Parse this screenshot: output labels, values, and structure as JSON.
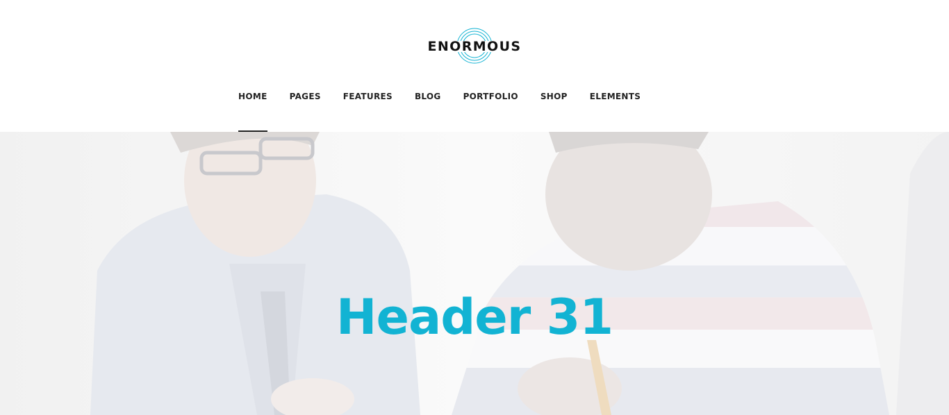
{
  "brand": {
    "name": "ENORMOUS",
    "accent_color": "#12b3d3"
  },
  "nav": {
    "items": [
      {
        "label": "HOME",
        "active": true
      },
      {
        "label": "PAGES"
      },
      {
        "label": "FEATURES"
      },
      {
        "label": "BLOG"
      },
      {
        "label": "PORTFOLIO"
      },
      {
        "label": "SHOP"
      },
      {
        "label": "ELEMENTS"
      }
    ]
  },
  "hero": {
    "title": "Header 31",
    "background": "faded-photo-two-men-talking"
  }
}
